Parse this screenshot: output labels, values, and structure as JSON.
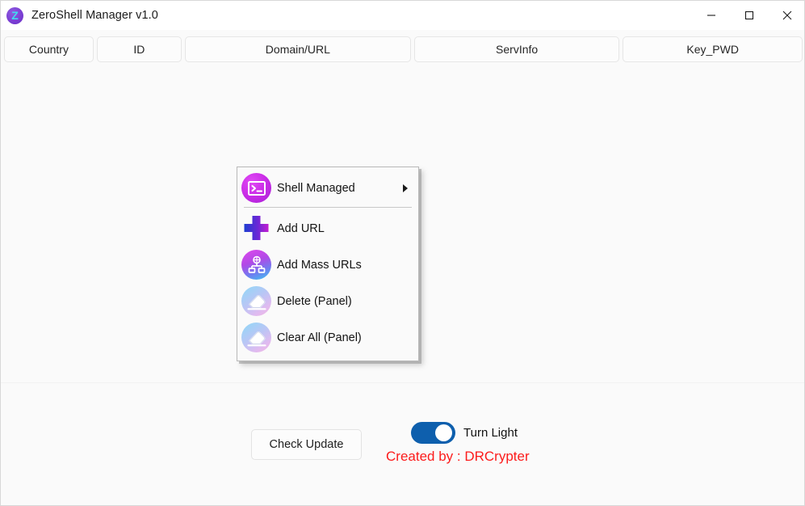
{
  "window": {
    "title": "ZeroShell Manager v1.0",
    "icon": "app-logo-z",
    "icon_letter": "Z",
    "controls": {
      "minimize": "minimize-icon",
      "maximize": "maximize-icon",
      "close": "close-icon"
    }
  },
  "columns": [
    {
      "label": "Country"
    },
    {
      "label": "ID"
    },
    {
      "label": "Domain/URL"
    },
    {
      "label": "ServInfo"
    },
    {
      "label": "Key_PWD"
    }
  ],
  "context_menu": {
    "items": [
      {
        "label": "Shell Managed",
        "icon": "terminal-icon",
        "has_submenu": true
      },
      {
        "label": "Add URL",
        "icon": "plus-icon",
        "has_submenu": false
      },
      {
        "label": "Add Mass URLs",
        "icon": "sitemap-icon",
        "has_submenu": false
      },
      {
        "label": "Delete (Panel)",
        "icon": "eraser-icon",
        "has_submenu": false
      },
      {
        "label": "Clear All (Panel)",
        "icon": "eraser-icon",
        "has_submenu": false
      }
    ]
  },
  "footer": {
    "check_update_label": "Check Update",
    "toggle_label": "Turn Light",
    "toggle_state": "on",
    "credit": "Created by : DRCrypter"
  },
  "colors": {
    "accent_blue": "#0e5fad",
    "credit_red": "#fc1b1b",
    "background": "#fafafa",
    "titlebar": "#ffffff",
    "icon_purple": "#7b3fd4",
    "icon_cyan": "#3fdcf0"
  }
}
